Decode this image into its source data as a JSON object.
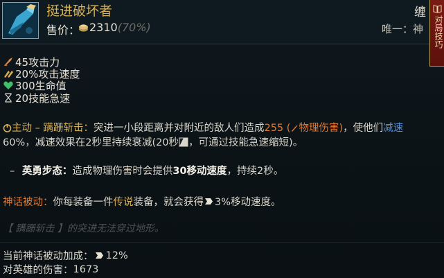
{
  "item": {
    "name": "挺进破坏者",
    "price_label": "售价：",
    "price_value": "2310",
    "price_percent": "(70%)",
    "tag_top": "缠",
    "tag_unique": "唯一：神"
  },
  "side_tab": {
    "label": "对局技巧"
  },
  "stats": [
    {
      "icon": "sword-icon",
      "text": "45攻击力"
    },
    {
      "icon": "attack-speed-icon",
      "text": "20%攻击速度"
    },
    {
      "icon": "heart-icon",
      "text": "300生命值"
    },
    {
      "icon": "hourglass-icon",
      "text": "20技能急速"
    }
  ],
  "ability": {
    "active_prefix": "主动 – 蹒跚斩击：",
    "text1": "突进一小段距离并对附近的敌人们造成",
    "damage_value": "255",
    "damage_type": "物理伤害",
    "text2": "，使他们",
    "slow_word": "减速",
    "text3": "60%，减速效果在2秒里持续衰减(20秒",
    "text4": "，可通过技能急速缩短)。"
  },
  "sub_bullet": {
    "dash": "–",
    "name": "英勇步态：",
    "text1": "造成物理伤害时会提供",
    "bold": "30移动速度",
    "text2": "，持续2秒。"
  },
  "mythic": {
    "label": "神话被动：",
    "text1": "你每装备一件",
    "legendary": "传说",
    "text2": "装备，就会获得",
    "value": "3%移动速度",
    "text3": "。"
  },
  "quote": "【 蹒跚斩击 】的突进无法穿过地形。",
  "footer": {
    "mythic_bonus_label": "当前神话被动加成：",
    "mythic_bonus_value": "12%",
    "champion_damage_label": "对英雄的伤害：",
    "champion_damage_value": "1673"
  },
  "colors": {
    "gold": "#d8b155",
    "orange": "#e07b35",
    "slow_blue": "#5a8fd6",
    "health_green": "#3fbf6a"
  }
}
